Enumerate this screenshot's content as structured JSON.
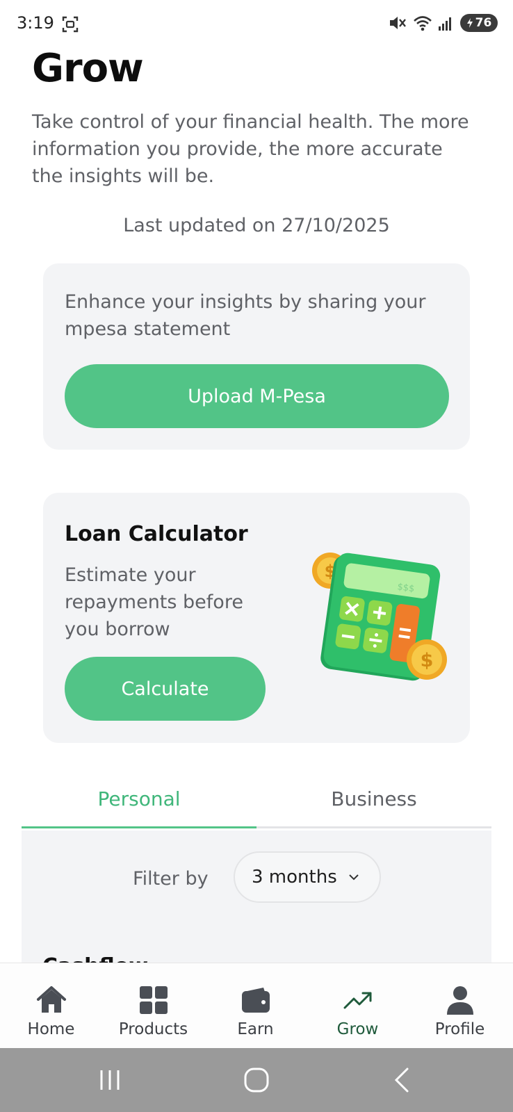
{
  "status_bar": {
    "time": "3:19",
    "battery": "76",
    "icons": [
      "screenshot-icon",
      "mute-icon",
      "wifi-icon",
      "signal-icon",
      "battery-icon"
    ]
  },
  "header": {
    "title": "Grow",
    "description": "Take control of your financial health. The more information you provide, the more accurate the insights will be."
  },
  "last_updated": "Last updated on 27/10/2025",
  "mpesa_card": {
    "text": "Enhance your insights by sharing your mpesa statement",
    "button_label": "Upload M-Pesa"
  },
  "loan_card": {
    "title": "Loan Calculator",
    "description": "Estimate your repayments before you borrow",
    "button_label": "Calculate",
    "illustration_text": "$$$"
  },
  "tabs": [
    {
      "label": "Personal",
      "active": true
    },
    {
      "label": "Business",
      "active": false
    }
  ],
  "filter": {
    "label": "Filter by",
    "selected": "3 months"
  },
  "section_peek": "Cashflow",
  "bottom_nav": [
    {
      "label": "Home",
      "icon": "home-icon",
      "active": false
    },
    {
      "label": "Products",
      "icon": "grid-icon",
      "active": false
    },
    {
      "label": "Earn",
      "icon": "wallet-icon",
      "active": false
    },
    {
      "label": "Grow",
      "icon": "trending-up-icon",
      "active": true
    },
    {
      "label": "Profile",
      "icon": "user-icon",
      "active": false
    }
  ],
  "colors": {
    "accent": "#52c487",
    "active_tab": "#3fb67a",
    "card_bg": "#f3f4f6",
    "active_nav": "#1f5a3b",
    "system_nav_bg": "#9a9a9a"
  }
}
